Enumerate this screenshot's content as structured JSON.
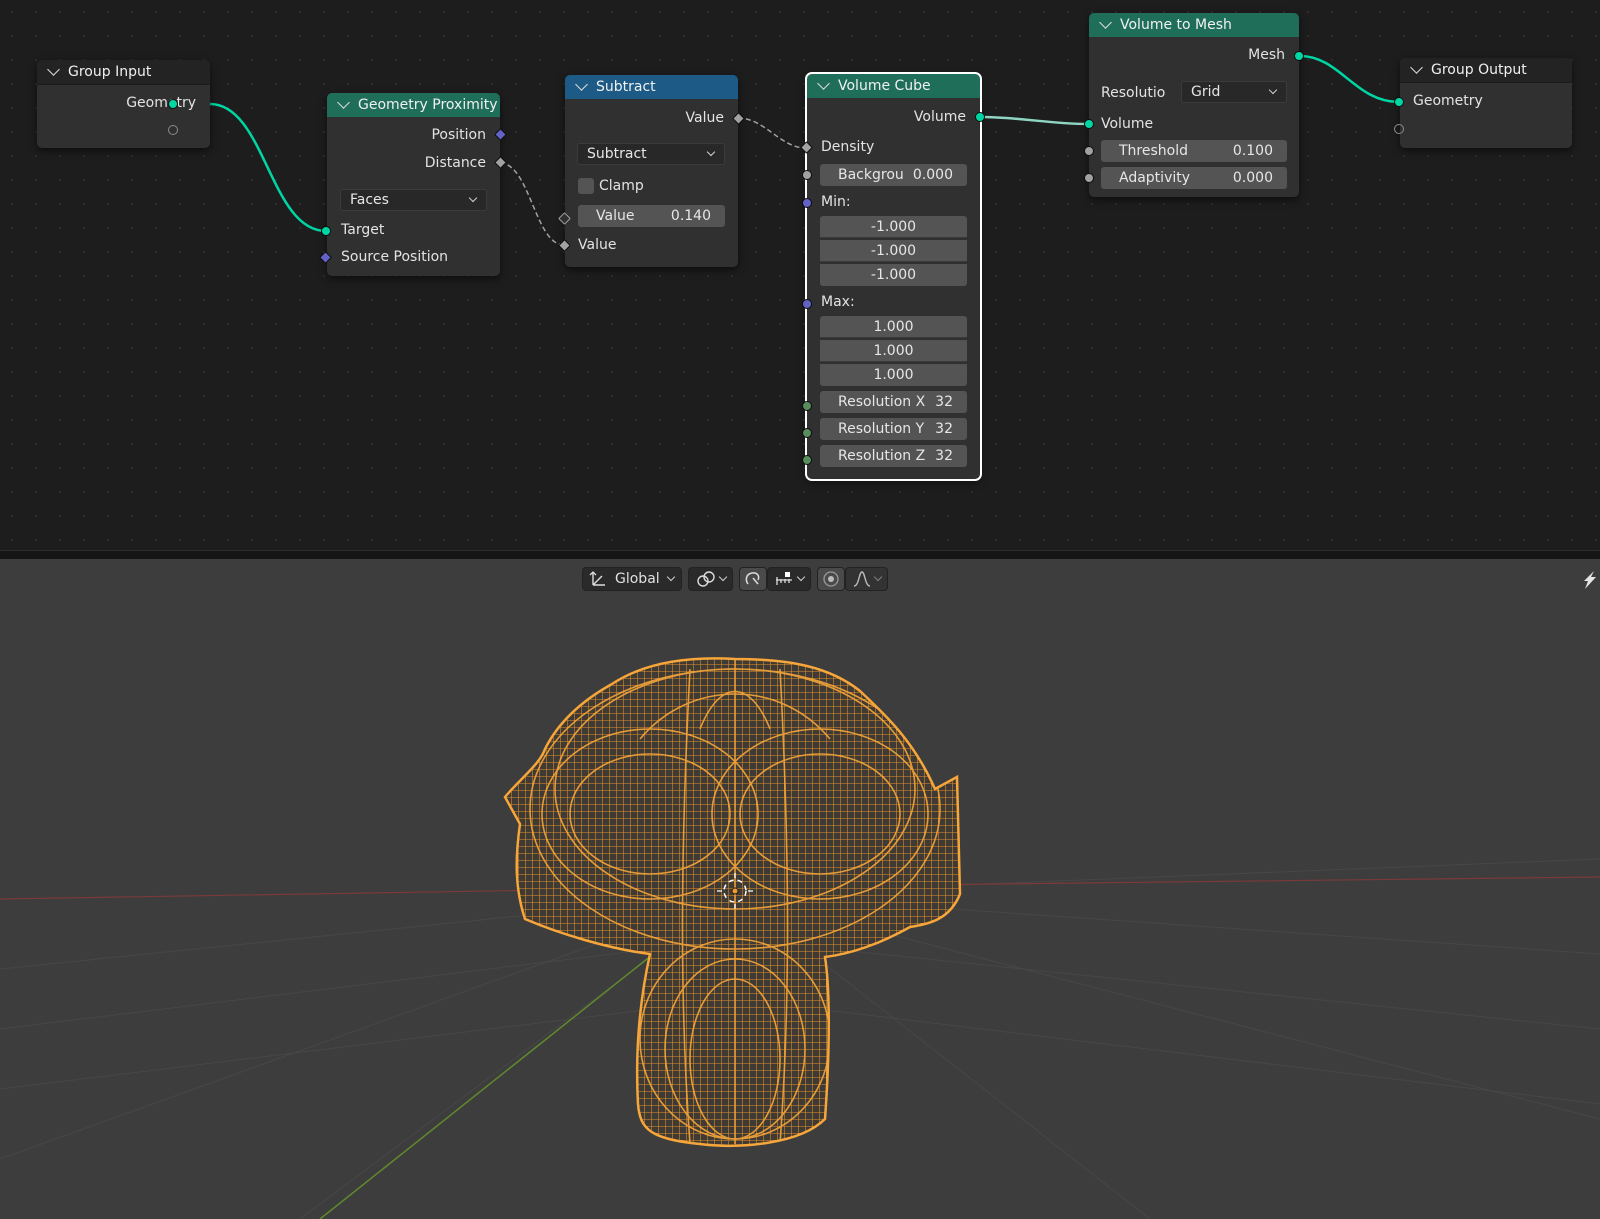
{
  "nodes": {
    "group_input": {
      "title": "Group Input",
      "out_geometry": "Geometry"
    },
    "geometry_proximity": {
      "title": "Geometry Proximity",
      "out_position": "Position",
      "out_distance": "Distance",
      "mode": "Faces",
      "in_target": "Target",
      "in_source_position": "Source Position"
    },
    "subtract": {
      "title": "Subtract",
      "out_value": "Value",
      "operation": "Subtract",
      "clamp_label": "Clamp",
      "in_value1_label": "Value",
      "in_value1": "0.140",
      "in_value2": "Value"
    },
    "volume_cube": {
      "title": "Volume Cube",
      "out_volume": "Volume",
      "in_density": "Density",
      "background_label": "Backgrou",
      "background": "0.000",
      "min_label": "Min:",
      "min": [
        "-1.000",
        "-1.000",
        "-1.000"
      ],
      "max_label": "Max:",
      "max": [
        "1.000",
        "1.000",
        "1.000"
      ],
      "res_x_label": "Resolution X",
      "res_x": "32",
      "res_y_label": "Resolution Y",
      "res_y": "32",
      "res_z_label": "Resolution Z",
      "res_z": "32"
    },
    "volume_to_mesh": {
      "title": "Volume to Mesh",
      "out_mesh": "Mesh",
      "resolution_label": "Resolutio",
      "resolution": "Grid",
      "in_volume": "Volume",
      "threshold_label": "Threshold",
      "threshold": "0.100",
      "adaptivity_label": "Adaptivity",
      "adaptivity": "0.000"
    },
    "group_output": {
      "title": "Group Output",
      "in_geometry": "Geometry"
    }
  },
  "viewport": {
    "orientation": "Global",
    "icons": [
      "transform-orientation-icon",
      "pivot-icon",
      "snap-magnet-icon",
      "snap-increment-icon",
      "proportional-edit-icon",
      "falloff-curve-icon"
    ]
  },
  "colors": {
    "geometry_socket": "#00d6a3",
    "vector_socket": "#6363c7",
    "integer_socket": "#598c5c",
    "wireframe": "#f29a2e",
    "node_green": "#1f6e5a",
    "node_blue": "#1d5b86"
  }
}
